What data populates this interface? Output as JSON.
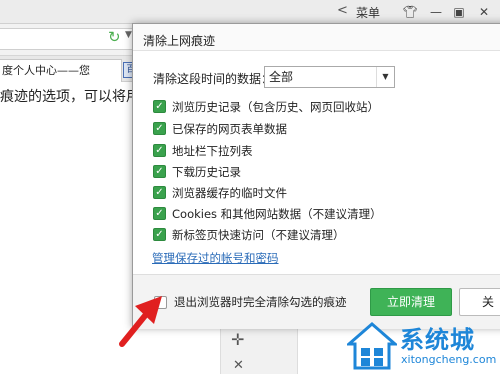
{
  "browser": {
    "menu_label": "菜单",
    "tab_title": "度个人中心——您",
    "tab2_icon": "百",
    "content_text": "痕迹的选项，可以将用"
  },
  "dialog": {
    "title": "清除上网痕迹",
    "range_label": "清除这段时间的数据：",
    "range_value": "全部",
    "options": [
      {
        "label": "浏览历史记录（包含历史、网页回收站）",
        "checked": true
      },
      {
        "label": "已保存的网页表单数据",
        "checked": true
      },
      {
        "label": "地址栏下拉列表",
        "checked": true
      },
      {
        "label": "下载历史记录",
        "checked": true
      },
      {
        "label": "浏览器缓存的临时文件",
        "checked": true
      },
      {
        "label": "Cookies 和其他网站数据（不建议清理）",
        "checked": true
      },
      {
        "label": "新标签页快速访问（不建议清理）",
        "checked": true
      }
    ],
    "manage_link": "管理保存过的帐号和密码",
    "exit_label": "退出浏览器时完全清除勾选的痕迹",
    "exit_checked": false,
    "clear_button": "立即清理",
    "close_button": "关"
  },
  "watermark": {
    "brand": "系统城",
    "url": "xitongcheng.com"
  },
  "colors": {
    "accent_green": "#3fb357",
    "link_blue": "#2a6bb8",
    "annotation_red": "#e02020",
    "watermark_blue": "#1e86d8"
  }
}
